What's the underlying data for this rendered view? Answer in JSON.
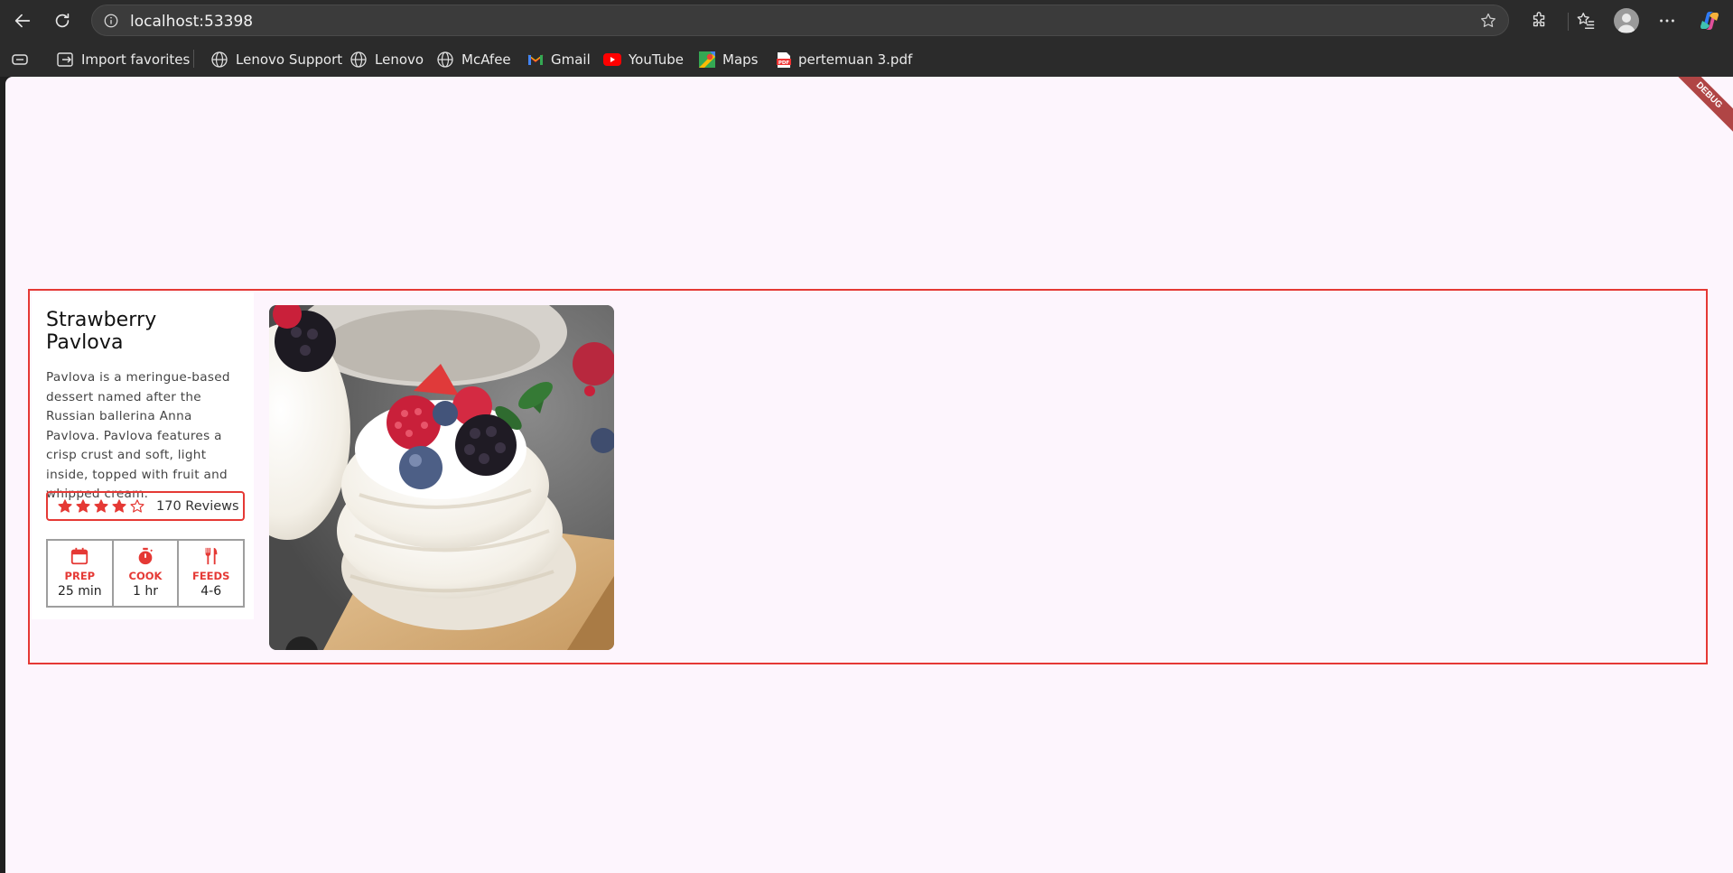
{
  "browser": {
    "url": "localhost:53398",
    "bookmarks": [
      {
        "label": "Import favorites",
        "icon": "import-icon"
      },
      {
        "label": "Lenovo Support",
        "icon": "globe-icon"
      },
      {
        "label": "Lenovo",
        "icon": "globe-icon"
      },
      {
        "label": "McAfee",
        "icon": "globe-icon"
      },
      {
        "label": "Gmail",
        "icon": "gmail-icon"
      },
      {
        "label": "YouTube",
        "icon": "youtube-icon"
      },
      {
        "label": "Maps",
        "icon": "maps-icon"
      },
      {
        "label": "pertemuan 3.pdf",
        "icon": "pdf-icon"
      }
    ]
  },
  "app": {
    "debug_banner": "DEBUG",
    "accent_color": "#e53935",
    "background_color": "#fdf5fd"
  },
  "recipe": {
    "title": "Strawberry Pavlova",
    "description": "Pavlova is a meringue-based dessert named after the Russian ballerina Anna Pavlova. Pavlova features a crisp crust and soft, light inside, topped with fruit and whipped cream.",
    "rating": 4,
    "rating_max": 5,
    "reviews": "170 Reviews",
    "stats": [
      {
        "icon": "calendar-icon",
        "label": "PREP",
        "value": "25 min"
      },
      {
        "icon": "timer-icon",
        "label": "COOK",
        "value": "1 hr"
      },
      {
        "icon": "restaurant-icon",
        "label": "FEEDS",
        "value": "4-6"
      }
    ]
  }
}
